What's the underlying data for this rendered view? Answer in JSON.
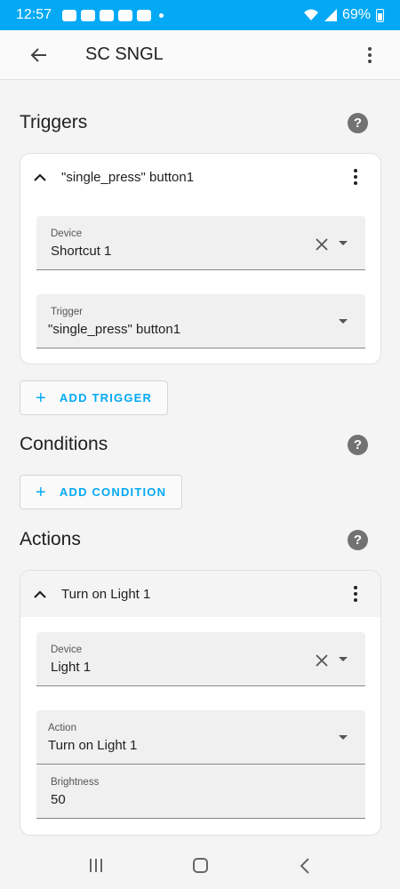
{
  "status_bar": {
    "time": "12:57",
    "battery": "69%"
  },
  "app_bar": {
    "title": "SC SNGL"
  },
  "triggers": {
    "title": "Triggers",
    "card": {
      "title": "\"single_press\" button1",
      "device": {
        "label": "Device",
        "value": "Shortcut 1"
      },
      "trigger": {
        "label": "Trigger",
        "value": "\"single_press\" button1"
      }
    },
    "add_label": "ADD TRIGGER"
  },
  "conditions": {
    "title": "Conditions",
    "add_label": "ADD CONDITION"
  },
  "actions": {
    "title": "Actions",
    "card": {
      "title": "Turn on Light 1",
      "device": {
        "label": "Device",
        "value": "Light 1"
      },
      "action": {
        "label": "Action",
        "value": "Turn on Light 1"
      },
      "brightness": {
        "label": "Brightness",
        "value": "50"
      }
    }
  },
  "colors": {
    "accent": "#03a9f4",
    "background": "#f4f4f4"
  }
}
